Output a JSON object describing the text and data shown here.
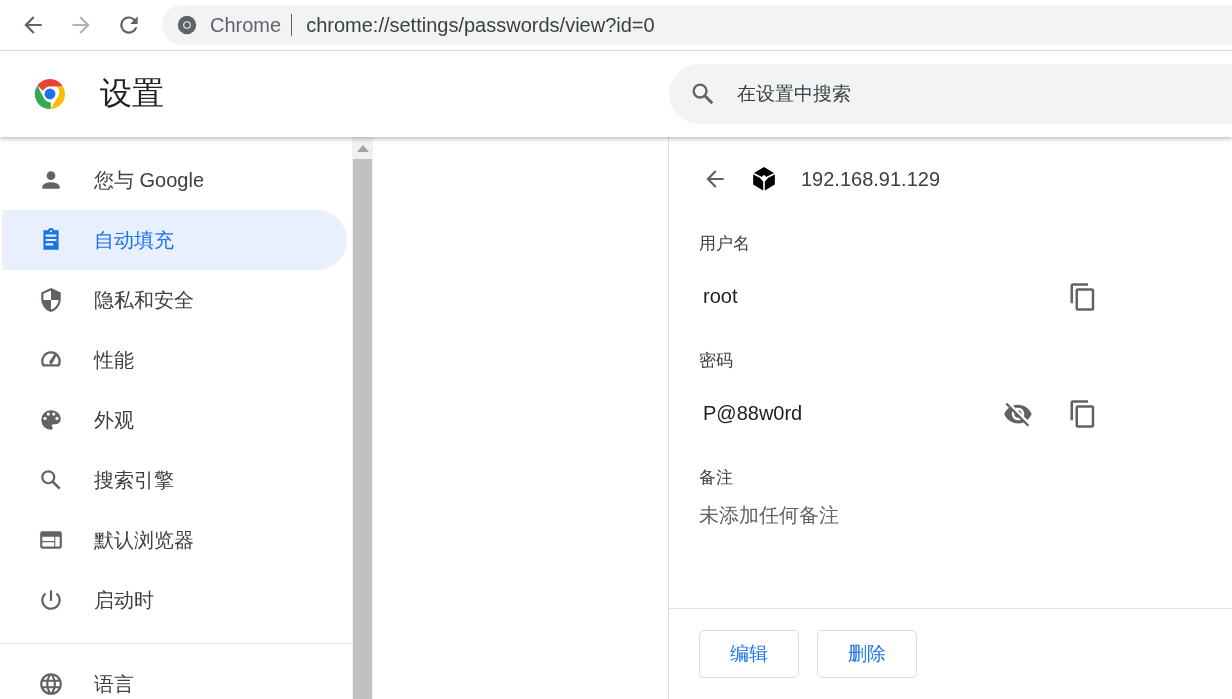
{
  "toolbar": {
    "site_label": "Chrome",
    "url": "chrome://settings/passwords/view?id=0"
  },
  "header": {
    "title": "设置",
    "search": {
      "placeholder": "在设置中搜索"
    }
  },
  "sidebar": {
    "sections": [
      [
        {
          "label": "您与 Google",
          "selected": false
        },
        {
          "label": "自动填充",
          "selected": true
        },
        {
          "label": "隐私和安全",
          "selected": false
        },
        {
          "label": "性能",
          "selected": false
        },
        {
          "label": "外观",
          "selected": false
        },
        {
          "label": "搜索引擎",
          "selected": false
        },
        {
          "label": "默认浏览器",
          "selected": false
        },
        {
          "label": "启动时",
          "selected": false
        }
      ],
      [
        {
          "label": "语言",
          "selected": false
        }
      ]
    ]
  },
  "detail": {
    "site": "192.168.91.129",
    "fields": [
      {
        "kind": "text",
        "label": "用户名",
        "value": "root"
      },
      {
        "kind": "password",
        "label": "密码",
        "value": "P@88w0rd",
        "revealed": true
      },
      {
        "kind": "note",
        "label": "备注",
        "value": "未添加任何备注"
      }
    ],
    "buttons": [
      "编辑",
      "删除"
    ]
  }
}
